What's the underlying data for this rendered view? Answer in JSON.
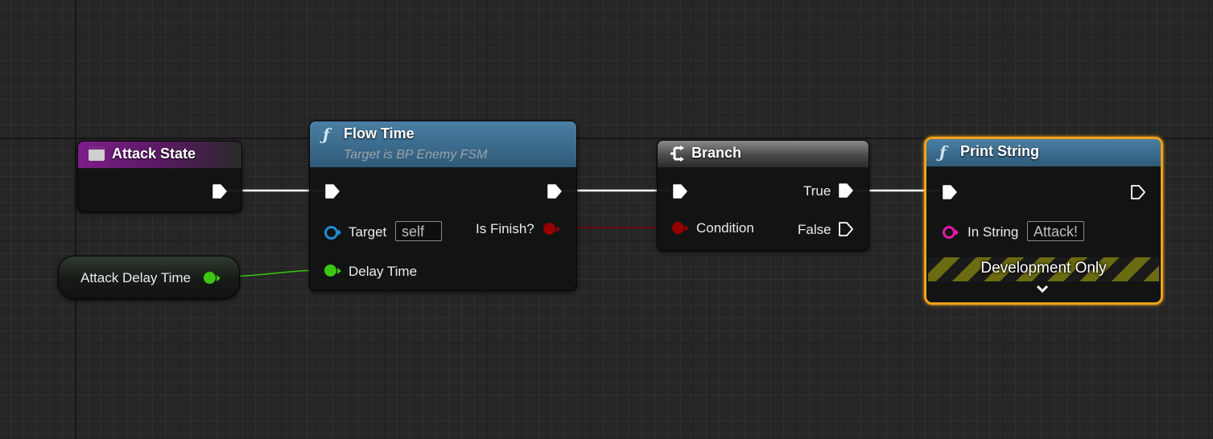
{
  "colors": {
    "exec": "#ffffff",
    "boolean": "#950000",
    "float": "#3cc613",
    "object": "#1f8fd6",
    "string": "#e21ca6",
    "enum_header": "#7d1f8a",
    "function_header": "#3b6e8d",
    "branch_header": "#6b6b6b",
    "selection": "#f1a21a"
  },
  "nodes": {
    "attack_state": {
      "title": "Attack State",
      "icon": "enum-icon"
    },
    "attack_delay_time": {
      "label": "Attack Delay Time"
    },
    "flow_time": {
      "title": "Flow Time",
      "subtitle": "Target is BP Enemy FSM",
      "icon": "function-icon",
      "pins": {
        "target_label": "Target",
        "target_value": "self",
        "delay_time_label": "Delay Time",
        "is_finish_label": "Is Finish?"
      }
    },
    "branch": {
      "title": "Branch",
      "icon": "branch-icon",
      "pins": {
        "condition_label": "Condition",
        "true_label": "True",
        "false_label": "False"
      }
    },
    "print_string": {
      "title": "Print String",
      "icon": "function-icon",
      "pins": {
        "in_string_label": "In String",
        "in_string_value": "Attack!"
      },
      "banner": "Development Only",
      "expand_icon": "chevron-down-icon"
    }
  }
}
